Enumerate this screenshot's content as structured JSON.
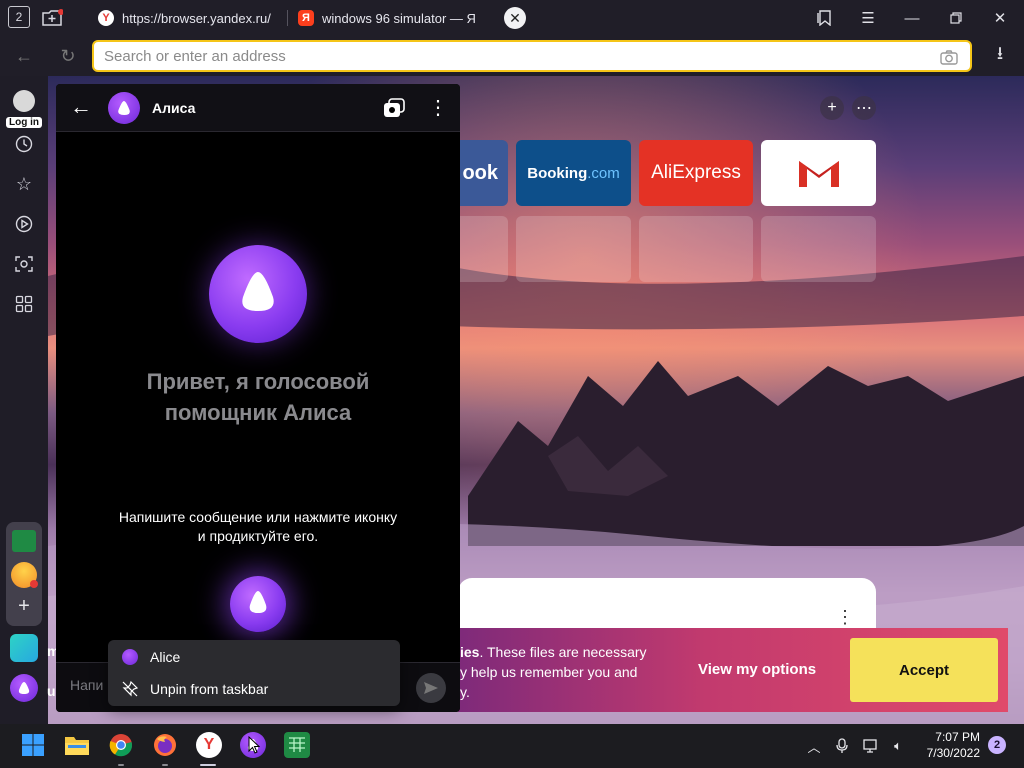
{
  "browser": {
    "tab_count": "2",
    "tabs": [
      {
        "label": "https://browser.yandex.ru/",
        "favicon": "yandex-y-icon"
      },
      {
        "label": "windows 96 simulator — Я",
        "favicon": "yandex-search-icon"
      }
    ],
    "address_placeholder": "Search or enter an address"
  },
  "sidebar": {
    "login_label": "Log in"
  },
  "speed_dial": {
    "tiles": [
      {
        "label": "ook"
      },
      {
        "label": "Booking",
        "label_suffix": ".com"
      },
      {
        "label": "AliExpress"
      },
      {
        "label": "M"
      }
    ]
  },
  "alice": {
    "title": "Алиса",
    "greeting": "Привет, я голосовой помощник Алиса",
    "hint": "Напишите сообщение или нажмите иконку и продиктуйте его.",
    "input_placeholder": "Напи"
  },
  "context_menu": {
    "items": [
      {
        "label": "Alice",
        "icon": "alice-icon"
      },
      {
        "label": "Unpin from taskbar",
        "icon": "unpin-icon"
      }
    ]
  },
  "cookie": {
    "text_bold": "ies",
    "text_rest": ". These files are necessary",
    "line2": "y help us remember you and",
    "line3": "y.",
    "view_options": "View my options",
    "accept": "Accept"
  },
  "left_snippets": {
    "a": "m",
    "b": "u"
  },
  "taskbar": {
    "time": "7:07 PM",
    "date": "7/30/2022",
    "notification_count": "2"
  },
  "colors": {
    "address_border": "#f5c518",
    "accept_bg": "#f5e15a",
    "alice_purple": "#8a3cf0"
  }
}
